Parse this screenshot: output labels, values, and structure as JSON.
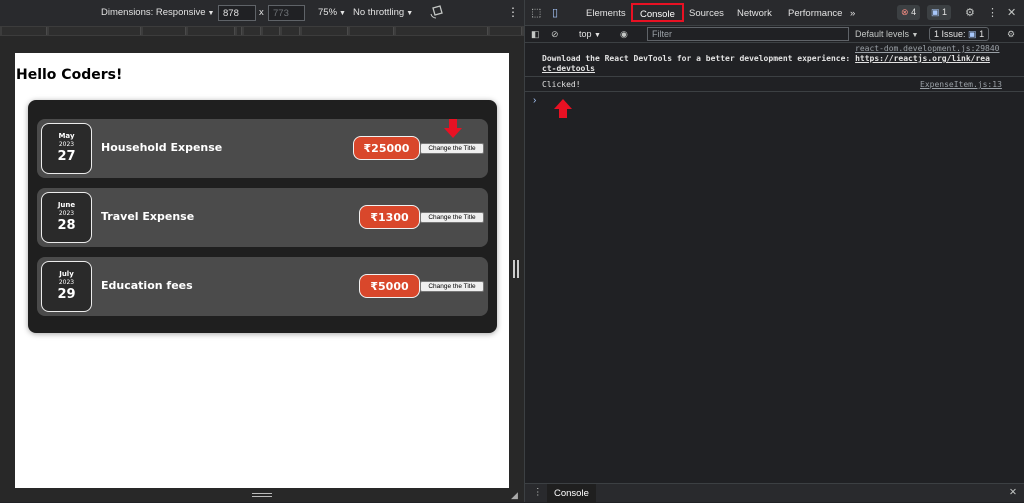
{
  "device_toolbar": {
    "dimensions_label": "Dimensions: Responsive",
    "width_value": "878",
    "times": "x",
    "height_placeholder": "773",
    "zoom": "75%",
    "throttling": "No throttling",
    "rotate_icon": "rotate-icon",
    "more_icon": "kebab-icon"
  },
  "page": {
    "heading": "Hello Coders!",
    "expenses": [
      {
        "month": "May",
        "year": "2023",
        "day": "27",
        "title": "Household Expense",
        "amount": "₹25000",
        "button": "Change the Title"
      },
      {
        "month": "June",
        "year": "2023",
        "day": "28",
        "title": "Travel Expense",
        "amount": "₹1300",
        "button": "Change the Title"
      },
      {
        "month": "July",
        "year": "2023",
        "day": "29",
        "title": "Education fees",
        "amount": "₹5000",
        "button": "Change the Title"
      }
    ],
    "annotation_color": "#e81123"
  },
  "devtools": {
    "tabs": [
      "Elements",
      "Console",
      "Sources",
      "Network",
      "Performance"
    ],
    "more_tabs": "»",
    "error_count": "4",
    "message_count": "1",
    "console_toolbar": {
      "context": "top",
      "filter_placeholder": "Filter",
      "levels": "Default levels",
      "issues_label": "1 Issue:",
      "issues_count": "1"
    },
    "messages": [
      {
        "source": "react-dom.development.js:29840",
        "text_line1": "Download the React DevTools for a better development experience: ",
        "link_part1": "https://reactjs.org/link/rea",
        "link_part2": "ct-devtools"
      },
      {
        "source": "ExpenseItem.js:13",
        "text": "Clicked!"
      }
    ],
    "prompt": "›",
    "drawer_tab": "Console",
    "accent": "#a8c7fa"
  }
}
